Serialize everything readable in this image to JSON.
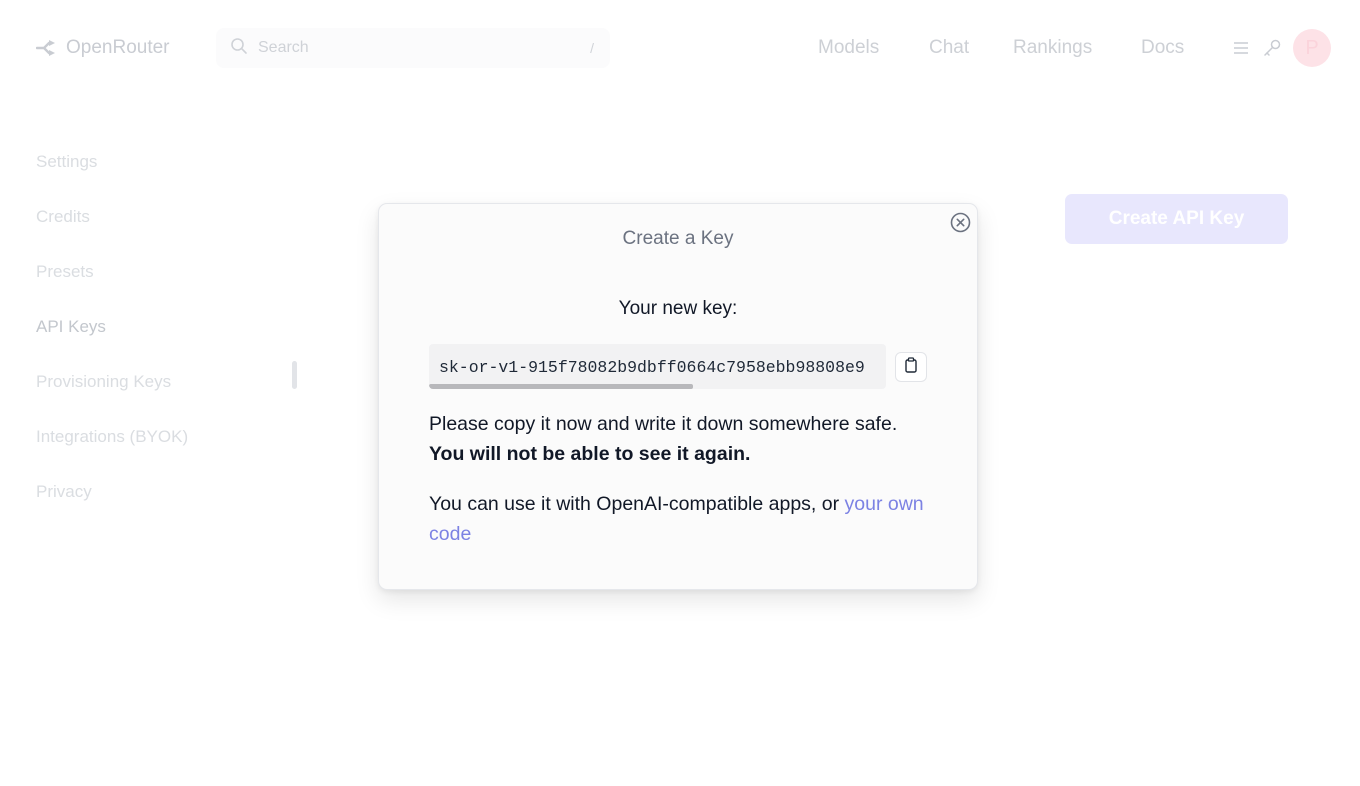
{
  "header": {
    "logo_text": "OpenRouter",
    "search_placeholder": "Search",
    "search_shortcut": "/",
    "nav": [
      {
        "label": "Models"
      },
      {
        "label": "Chat"
      },
      {
        "label": "Rankings"
      },
      {
        "label": "Docs"
      }
    ],
    "avatar_initial": "P"
  },
  "sidebar": {
    "items": [
      {
        "label": "Settings"
      },
      {
        "label": "Credits"
      },
      {
        "label": "Presets"
      },
      {
        "label": "API Keys"
      },
      {
        "label": "Provisioning Keys"
      },
      {
        "label": "Integrations (BYOK)"
      },
      {
        "label": "Privacy"
      }
    ]
  },
  "main": {
    "create_button": "Create API Key"
  },
  "modal": {
    "title": "Create a Key",
    "new_key_label": "Your new key:",
    "key_value": "sk-or-v1-915f78082b9dbff0664c7958ebb98808e9",
    "warning_text": "Please copy it now and write it down somewhere safe. ",
    "warning_bold": "You will not be able to see it again.",
    "usage_text": "You can use it with OpenAI-compatible apps, or ",
    "usage_link": "your own code"
  },
  "colors": {
    "accent_link": "#7c82e3",
    "create_button_bg": "#e8e7fd",
    "avatar_bg": "#fde2e7"
  },
  "icons": {
    "logo": "openrouter-logo-icon",
    "search": "search-icon",
    "menu": "hamburger-menu-icon",
    "key": "key-icon",
    "close": "close-circle-icon",
    "copy": "clipboard-copy-icon"
  }
}
